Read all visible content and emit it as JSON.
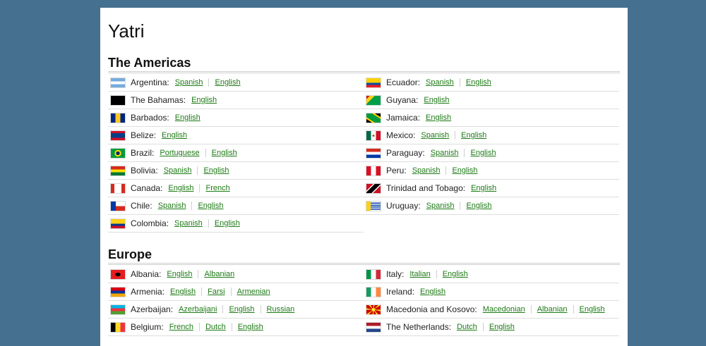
{
  "site": {
    "title": "Yatri"
  },
  "regions": [
    {
      "title": "The Americas",
      "columns": [
        [
          {
            "name": "Argentina",
            "flag": "argentina",
            "langs": [
              "Spanish",
              "English"
            ]
          },
          {
            "name": "The Bahamas",
            "flag": "bahamas",
            "langs": [
              "English"
            ]
          },
          {
            "name": "Barbados",
            "flag": "barbados",
            "langs": [
              "English"
            ]
          },
          {
            "name": "Belize",
            "flag": "belize",
            "langs": [
              "English"
            ]
          },
          {
            "name": "Brazil",
            "flag": "brazil",
            "langs": [
              "Portuguese",
              "English"
            ]
          },
          {
            "name": "Bolivia",
            "flag": "bolivia",
            "langs": [
              "Spanish",
              "English"
            ]
          },
          {
            "name": "Canada",
            "flag": "canada",
            "langs": [
              "English",
              "French"
            ]
          },
          {
            "name": "Chile",
            "flag": "chile",
            "langs": [
              "Spanish",
              "English"
            ]
          },
          {
            "name": "Colombia",
            "flag": "colombia",
            "langs": [
              "Spanish",
              "English"
            ]
          }
        ],
        [
          {
            "name": "Ecuador",
            "flag": "ecuador",
            "langs": [
              "Spanish",
              "English"
            ]
          },
          {
            "name": "Guyana",
            "flag": "guyana",
            "langs": [
              "English"
            ]
          },
          {
            "name": "Jamaica",
            "flag": "jamaica",
            "langs": [
              "English"
            ]
          },
          {
            "name": "Mexico",
            "flag": "mexico",
            "langs": [
              "Spanish",
              "English"
            ]
          },
          {
            "name": "Paraguay",
            "flag": "paraguay",
            "langs": [
              "Spanish",
              "English"
            ]
          },
          {
            "name": "Peru",
            "flag": "peru",
            "langs": [
              "Spanish",
              "English"
            ]
          },
          {
            "name": "Trinidad and Tobago",
            "flag": "trinidad",
            "langs": [
              "English"
            ]
          },
          {
            "name": "Uruguay",
            "flag": "uruguay",
            "langs": [
              "Spanish",
              "English"
            ]
          }
        ]
      ]
    },
    {
      "title": "Europe",
      "columns": [
        [
          {
            "name": "Albania",
            "flag": "albania",
            "langs": [
              "English",
              "Albanian"
            ]
          },
          {
            "name": "Armenia",
            "flag": "armenia",
            "langs": [
              "English",
              "Farsi",
              "Armenian"
            ]
          },
          {
            "name": "Azerbaijan",
            "flag": "azerbaijan",
            "langs": [
              "Azerbaijani",
              "English",
              "Russian"
            ]
          },
          {
            "name": "Belgium",
            "flag": "belgium",
            "langs": [
              "French",
              "Dutch",
              "English"
            ]
          }
        ],
        [
          {
            "name": "Italy",
            "flag": "italy",
            "langs": [
              "Italian",
              "English"
            ]
          },
          {
            "name": "Ireland",
            "flag": "ireland",
            "langs": [
              "English"
            ]
          },
          {
            "name": "Macedonia and Kosovo",
            "flag": "macedonia",
            "langs": [
              "Macedonian",
              "Albanian",
              "English"
            ]
          },
          {
            "name": "The Netherlands",
            "flag": "netherlands",
            "langs": [
              "Dutch",
              "English"
            ]
          }
        ]
      ]
    }
  ],
  "colors": {
    "link": "#1e7a16",
    "background": "#45708f"
  }
}
